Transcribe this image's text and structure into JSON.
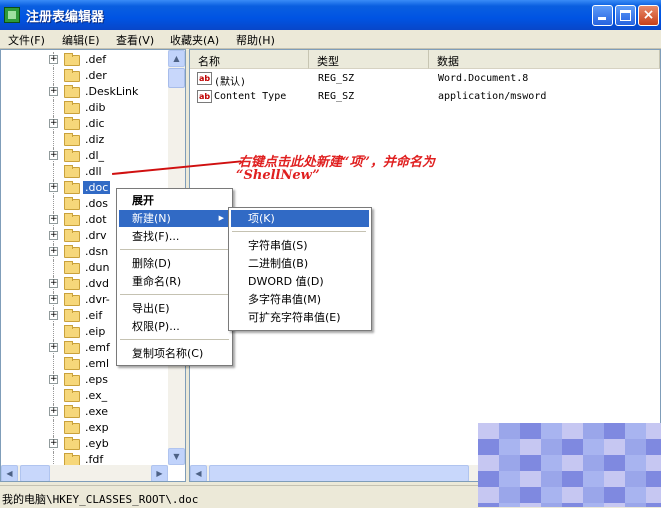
{
  "window": {
    "title": "注册表编辑器"
  },
  "menubar": {
    "items": [
      "文件(F)",
      "编辑(E)",
      "查看(V)",
      "收藏夹(A)",
      "帮助(H)"
    ]
  },
  "tree": {
    "items": [
      {
        "label": ".def"
      },
      {
        "label": ".der"
      },
      {
        "label": ".DeskLink"
      },
      {
        "label": ".dib"
      },
      {
        "label": ".dic"
      },
      {
        "label": ".diz"
      },
      {
        "label": ".dl_"
      },
      {
        "label": ".dll"
      },
      {
        "label": ".doc"
      },
      {
        "label": ".dos"
      },
      {
        "label": ".dot"
      },
      {
        "label": ".drv"
      },
      {
        "label": ".dsn"
      },
      {
        "label": ".dun"
      },
      {
        "label": ".dvd"
      },
      {
        "label": ".dvr-"
      },
      {
        "label": ".eif"
      },
      {
        "label": ".eip"
      },
      {
        "label": ".emf"
      },
      {
        "label": ".eml"
      },
      {
        "label": ".eps"
      },
      {
        "label": ".ex_"
      },
      {
        "label": ".exe"
      },
      {
        "label": ".exp"
      },
      {
        "label": ".eyb"
      },
      {
        "label": ".fdf"
      }
    ],
    "selected_label": ".doc"
  },
  "list": {
    "headers": {
      "name": "名称",
      "type": "类型",
      "data": "数据"
    },
    "rows": [
      {
        "icon": "string-value-icon",
        "icon_text": "ab",
        "name": "(默认)",
        "type": "REG_SZ",
        "data": "Word.Document.8"
      },
      {
        "icon": "string-value-icon",
        "icon_text": "ab",
        "name": "Content Type",
        "type": "REG_SZ",
        "data": "application/msword"
      }
    ]
  },
  "context_menu": {
    "items": [
      "展开",
      "新建(N)",
      "查找(F)...",
      "删除(D)",
      "重命名(R)",
      "导出(E)",
      "权限(P)...",
      "复制项名称(C)"
    ],
    "submenu_arrow": "▶"
  },
  "submenu": {
    "items": [
      "项(K)",
      "字符串值(S)",
      "二进制值(B)",
      "DWORD 值(D)",
      "多字符串值(M)",
      "可扩充字符串值(E)"
    ]
  },
  "annotation": {
    "line1": "右键点击此处新建“项”，并命名为",
    "line2": "“ShellNew”",
    "color": "#e02020"
  },
  "statusbar": {
    "path": "我的电脑\\HKEY_CLASSES_ROOT\\.doc"
  },
  "colors": {
    "title_bar": "#0054e3",
    "selection": "#316ac5",
    "annotation": "#e02020"
  }
}
